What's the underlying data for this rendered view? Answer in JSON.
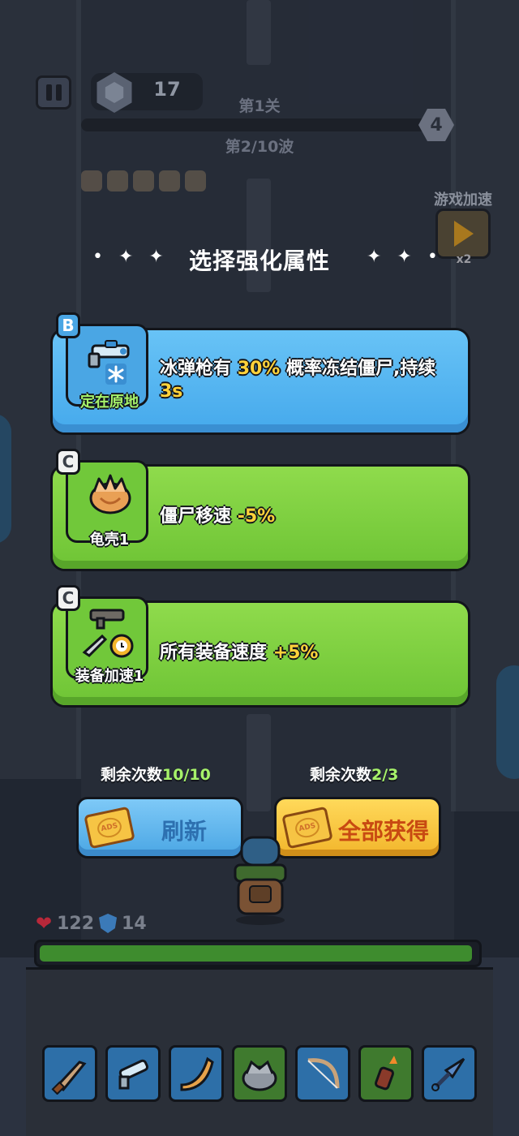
{
  "hud": {
    "coins": "17",
    "level": "第1关",
    "wave": "第2/10波",
    "wave_badge": "4",
    "speed_label": "游戏加速",
    "speed_multiplier": "x2"
  },
  "title": "选择强化属性",
  "cards": [
    {
      "rank": "B",
      "name": "定在原地",
      "icon": "ice-gun-icon",
      "desc_pre": "冰弹枪有",
      "desc_hl": "30%",
      "desc_mid": "概率冻结僵尸,持续",
      "desc_hl2": "3s",
      "color": "#4aa6e4"
    },
    {
      "rank": "C",
      "name": "龟壳1",
      "icon": "turtle-shell-icon",
      "desc_pre": "僵尸移速",
      "desc_hl": "-5%",
      "color": "#71c83a"
    },
    {
      "rank": "C",
      "name": "装备加速1",
      "icon": "equipment-speed-icon",
      "desc_pre": "所有装备速度",
      "desc_hl": "+5%",
      "color": "#71c83a"
    }
  ],
  "refresh": {
    "remain_label": "剩余次数",
    "remain_value": "10/10",
    "label": "刷新",
    "ticket_text": "ADS"
  },
  "get_all": {
    "remain_label": "剩余次数",
    "remain_value": "2/3",
    "label": "全部获得",
    "ticket_text": "ADS"
  },
  "stats": {
    "hp": "122",
    "shield": "14",
    "hp_fraction": 0.99
  },
  "inventory": [
    {
      "icon": "knife-icon"
    },
    {
      "icon": "ice-gun-icon"
    },
    {
      "icon": "boomerang-icon"
    },
    {
      "icon": "turtle-shell-icon"
    },
    {
      "icon": "bow-icon"
    },
    {
      "icon": "molotov-icon"
    },
    {
      "icon": "kunai-icon"
    }
  ]
}
